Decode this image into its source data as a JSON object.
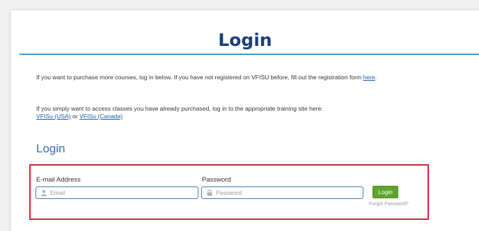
{
  "page": {
    "title": "Login"
  },
  "intro": {
    "purchase_text": "If you want to purchase more courses, log in below. If you have not registered on VFISU before, fill out the registration form ",
    "purchase_link": "here",
    "purchase_end": ".",
    "access_text": "If you simply want to access classes you have already purchased, log in to the appropriate training site here:",
    "usa_link": "VFISu (USA)",
    "or_text": " or ",
    "canada_link": "VFISu (Canada)"
  },
  "login_form": {
    "heading": "Login",
    "email_label": "E-mail Address",
    "email_placeholder": "Email",
    "email_value": "",
    "password_label": "Password",
    "password_placeholder": "Password",
    "password_value": "",
    "submit_label": "Login",
    "forgot_label": "Forgot Password?"
  },
  "colors": {
    "title": "#1a3f7a",
    "rule": "#3b9bd6",
    "link": "#1a5fa8",
    "highlight_border": "#d4213d",
    "button": "#5fa52c"
  },
  "icons": {
    "email_field": "user-icon",
    "password_field": "lock-icon"
  }
}
